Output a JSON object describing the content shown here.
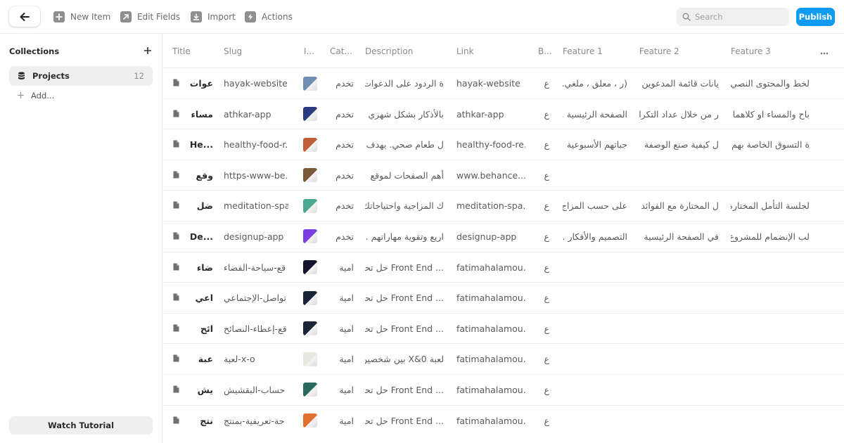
{
  "toolbar": {
    "new_item": "New Item",
    "edit_fields": "Edit Fields",
    "import": "Import",
    "actions": "Actions",
    "search_placeholder": "Search",
    "publish": "Publish"
  },
  "sidebar": {
    "title": "Collections",
    "items": [
      {
        "label": "Projects",
        "count": "12"
      }
    ],
    "add_label": "Add...",
    "watch_tutorial": "Watch Tutorial"
  },
  "table": {
    "columns": [
      "Title",
      "Slug",
      "I...",
      "Cat...",
      "Description",
      "Link",
      "B...",
      "Feature 1",
      "Feature 2",
      "Feature 3"
    ],
    "rows": [
      {
        "title": "عوات",
        "slug": "hayak-website",
        "thumb_color": "#6f8fb0",
        "category": "تخدم",
        "description": "ة الردود على الدعوات",
        "link": "hayak-website",
        "b": "ع",
        "f1": "(..ر ، معلق ، ملغي)",
        "f2": "يانات قائمة المدعوين",
        "f3": "لخط والمحتوى النصي"
      },
      {
        "title": "مساء",
        "slug": "athkar-app",
        "thumb_color": "#2b3b80",
        "category": "تخدم",
        "description": "... بالأذكار بشكل شهري",
        "link": "athkar-app",
        "b": "ع",
        "f1": "... الصفحة الرئيسية",
        "f2": "ر من خلال عداد التكرار",
        "f3": "باح والمساء او كلاهما"
      },
      {
        "title": "He...",
        "slug": "healthy-food-r...",
        "thumb_color": "#c0603a",
        "category": "تخدم",
        "description": "ل طعام صحي. يهدف",
        "link": "healthy-food-re...",
        "b": "ع",
        "f1": "جباتهم الأسبوعية",
        "f2": "ل كيفية صنع الوصفة",
        "f3": "ة التسوق الخاصة بهم"
      },
      {
        "title": "وقع",
        "slug": "https-www-be...",
        "thumb_color": "#7a5a3a",
        "category": "تخدم",
        "description": "أهم الصفحات لموقع",
        "link": "www.behance....",
        "b": "ع",
        "f1": "",
        "f2": "",
        "f3": ""
      },
      {
        "title": "ضل",
        "slug": "meditation-spa...",
        "thumb_color": "#4aa890",
        "category": "تخدم",
        "description": "... ك المزاجية واحتياجاتك",
        "link": "meditation-spa...",
        "b": "ع",
        "f1": "على حسب المزاج",
        "f2": "ل المختارة مع الفوائد",
        "f3": "لجلسة التأمل المختارة"
      },
      {
        "title": "De...",
        "slug": "designup-app",
        "thumb_color": "#7c3ee0",
        "category": "تخدم",
        "description": "... اريع وتقوية مهاراتهم",
        "link": "designup-app",
        "b": "ع",
        "f1": "... التصميم والأفكار",
        "f2": "في الصفحة الرئيسية",
        "f3": "لب الإنضمام للمشروع"
      },
      {
        "title": "ضاء",
        "slug": "قع-سياحة-الفضاء",
        "thumb_color": "#14142a",
        "category": "امية",
        "description": "حل تحدي Front End ...",
        "link": "fatimahalamou...",
        "b": "ع",
        "f1": "",
        "f2": "",
        "f3": ""
      },
      {
        "title": "اعي",
        "slug": "تواصل-الإجتماعي",
        "thumb_color": "#1a2438",
        "category": "امية",
        "description": "حل تحدي Front End ...",
        "link": "fatimahalamou...",
        "b": "ع",
        "f1": "",
        "f2": "",
        "f3": ""
      },
      {
        "title": "ائح",
        "slug": "قع-إعطاء-النصائح",
        "thumb_color": "#1b2536",
        "category": "امية",
        "description": "حل تحدي Front End ...",
        "link": "fatimahalamou...",
        "b": "ع",
        "f1": "",
        "f2": "",
        "f3": ""
      },
      {
        "title": "عبة",
        "slug": "لعبة-x-o",
        "thumb_color": "#e8e8e0",
        "category": "امية",
        "description": "بين شخصين X&0 لعبة",
        "link": "fatimahalamou...",
        "b": "ع",
        "f1": "",
        "f2": "",
        "f3": ""
      },
      {
        "title": "يش",
        "slug": "حساب-البقشيش",
        "thumb_color": "#2a6a5a",
        "category": "امية",
        "description": "حل تحدي Front End ...",
        "link": "fatimahalamou...",
        "b": "ع",
        "f1": "",
        "f2": "",
        "f3": ""
      },
      {
        "title": "نتج",
        "slug": "حة-تعريفية-بمنتج",
        "thumb_color": "#e07030",
        "category": "امية",
        "description": "حل تحدي Front End ...",
        "link": "fatimahalamou...",
        "b": "ع",
        "f1": "",
        "f2": "",
        "f3": ""
      }
    ]
  }
}
